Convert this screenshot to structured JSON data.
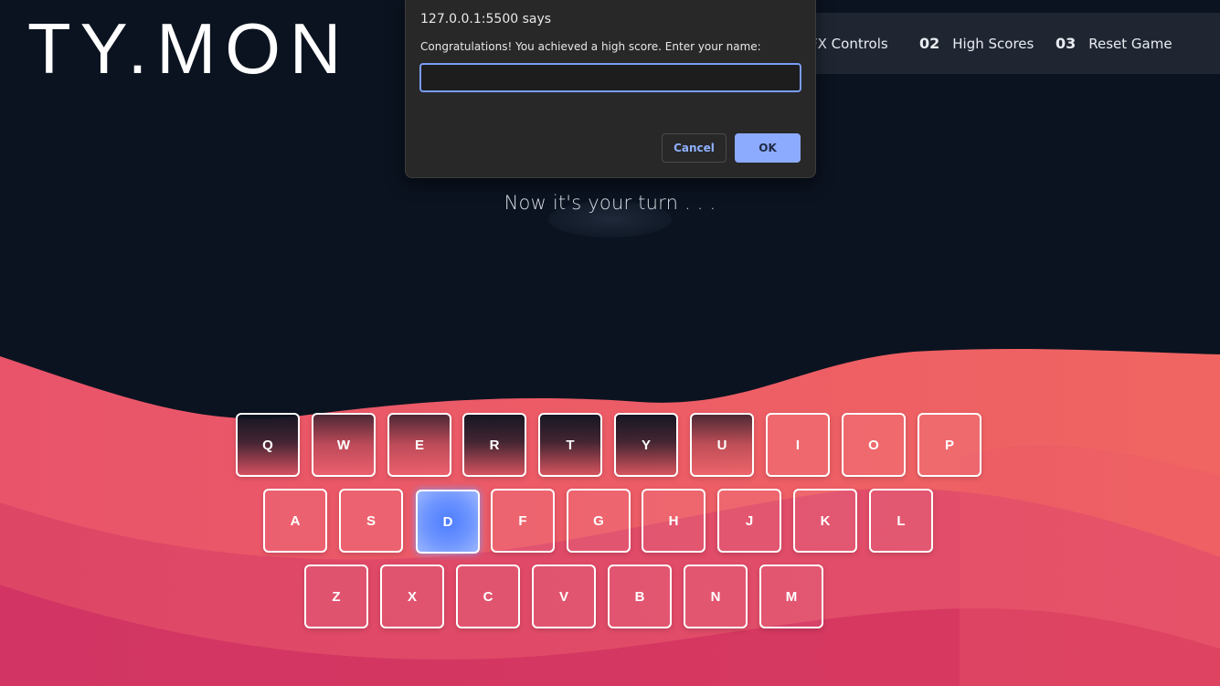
{
  "logo": {
    "text": "TY.MON"
  },
  "nav": {
    "items": [
      {
        "num": "",
        "label": "FX Controls"
      },
      {
        "num": "02",
        "label": "High Scores"
      },
      {
        "num": "03",
        "label": "Reset Game"
      }
    ]
  },
  "subtitle": "Now it's your turn . . .",
  "keyboard": {
    "rows": [
      [
        "Q",
        "W",
        "E",
        "R",
        "T",
        "Y",
        "U",
        "I",
        "O",
        "P"
      ],
      [
        "A",
        "S",
        "D",
        "F",
        "G",
        "H",
        "J",
        "K",
        "L"
      ],
      [
        "Z",
        "X",
        "C",
        "V",
        "B",
        "N",
        "M"
      ]
    ],
    "active_key": "D"
  },
  "dialog": {
    "title": "127.0.0.1:5500 says",
    "message": "Congratulations! You achieved a high score. Enter your name:",
    "input_value": "",
    "cancel_label": "Cancel",
    "ok_label": "OK"
  },
  "colors": {
    "background": "#0b1320",
    "wave_light": "#ef6461",
    "wave_mid": "#e04a62",
    "wave_dark": "#d3325f",
    "active_key": "#4d7dff",
    "nav_bg": "#1f2632"
  }
}
